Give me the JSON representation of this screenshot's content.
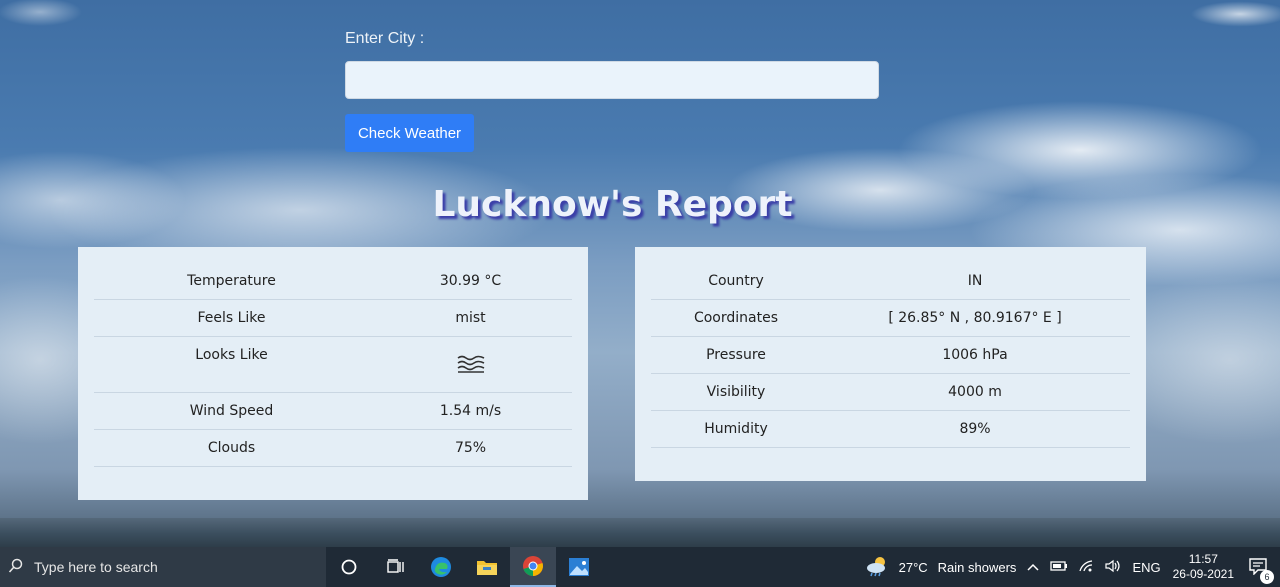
{
  "form": {
    "city_label": "Enter City :",
    "city_value": "",
    "button_label": "Check Weather"
  },
  "report": {
    "title": "Lucknow's Report"
  },
  "left_table": [
    {
      "label": "Temperature",
      "value": "30.99 °C"
    },
    {
      "label": "Feels Like",
      "value": "mist"
    },
    {
      "label": "Looks Like",
      "value_icon": "mist-icon"
    },
    {
      "label": "Wind Speed",
      "value": "1.54 m/s"
    },
    {
      "label": "Clouds",
      "value": "75%"
    }
  ],
  "right_table": [
    {
      "label": "Country",
      "value": "IN"
    },
    {
      "label": "Coordinates",
      "value": "[ 26.85° N , 80.9167° E ]"
    },
    {
      "label": "Pressure",
      "value": "1006 hPa"
    },
    {
      "label": "Visibility",
      "value": "4000 m"
    },
    {
      "label": "Humidity",
      "value": "89%"
    }
  ],
  "taskbar": {
    "search_placeholder": "Type here to search",
    "apps": [
      "cortana-icon",
      "task-view-icon",
      "edge-icon",
      "file-explorer-icon",
      "chrome-icon",
      "photos-icon"
    ],
    "weather_temp": "27°C",
    "weather_desc": "Rain showers",
    "language": "ENG",
    "time": "11:57",
    "date": "26-09-2021",
    "notification_count": "6"
  },
  "colors": {
    "button_bg": "#2f7df6",
    "card_bg": "#e4eef6",
    "title_shadow": "#3b3fa8",
    "taskbar_bg": "#1f2a36"
  }
}
